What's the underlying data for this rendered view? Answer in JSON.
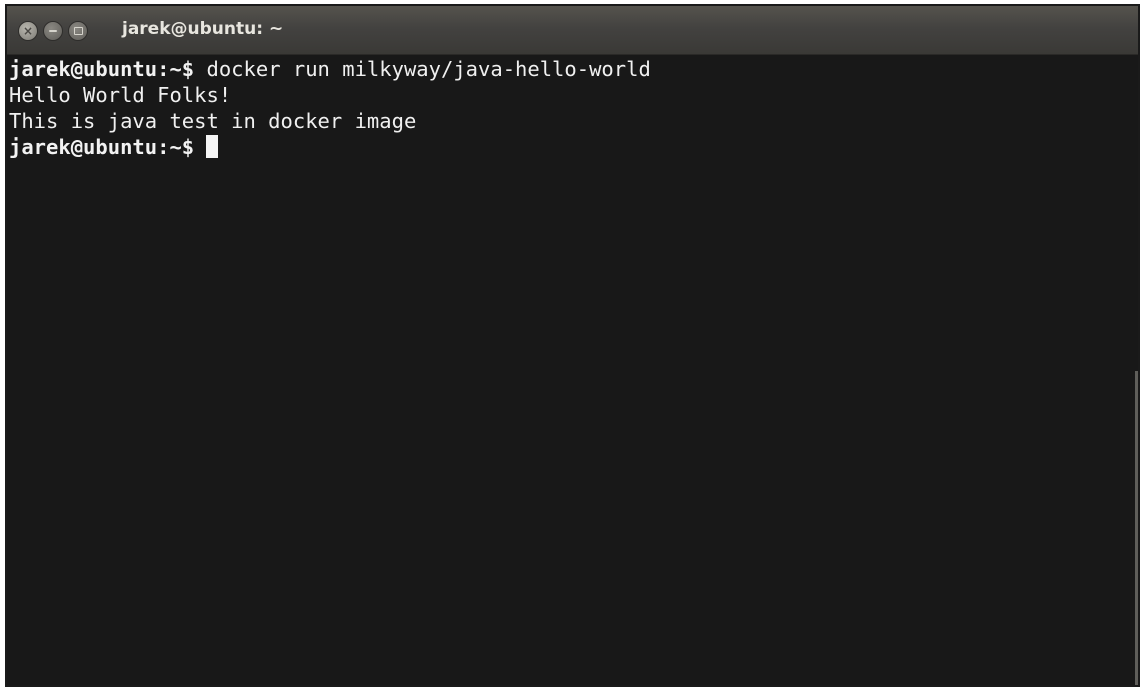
{
  "window": {
    "title": "jarek@ubuntu: ~",
    "controls": {
      "close_icon": "close-icon",
      "minimize_icon": "minimize-icon",
      "maximize_icon": "maximize-icon",
      "close_glyph": "×"
    }
  },
  "terminal": {
    "lines": [
      {
        "prompt": "jarek@ubuntu:~$",
        "text": " docker run milkyway/java-hello-world"
      },
      {
        "prompt": "",
        "text": "Hello World Folks!"
      },
      {
        "prompt": "",
        "text": "This is java test in docker image"
      },
      {
        "prompt": "jarek@ubuntu:~$",
        "text": " "
      }
    ]
  },
  "colors": {
    "terminal_background": "#181818",
    "terminal_text": "#f0f0f0",
    "titlebar": "#434240"
  }
}
